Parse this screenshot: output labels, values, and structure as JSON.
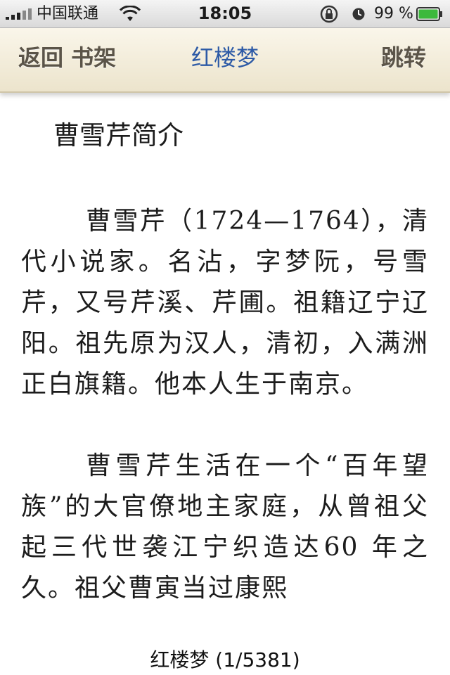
{
  "status_bar": {
    "carrier": "中国联通",
    "time": "18:05",
    "battery_percent": "99 %"
  },
  "nav": {
    "back_label": "返回 书架",
    "title": "红楼梦",
    "jump_label": "跳转"
  },
  "content": {
    "heading": "曹雪芹简介",
    "paragraphs": [
      "曹雪芹（1724—1764），清代小说家。名沾，字梦阮，号雪芹，又号芹溪、芹圃。祖籍辽宁辽阳。祖先原为汉人，清初，入满洲正白旗籍。他本人生于南京。",
      "曹雪芹生活在一个“百年望族”的大官僚地主家庭，从曾祖父起三代世袭江宁织造达60 年之久。祖父曹寅当过康熙"
    ]
  },
  "footer": {
    "book_title": "红楼梦",
    "page_indicator": "(1/5381)"
  },
  "colors": {
    "nav_title": "#2d5aa6",
    "nav_button": "#5b5448",
    "nav_background": "#f3eddb",
    "battery": "#3cb93c"
  },
  "icons": [
    "signal-icon",
    "wifi-icon",
    "rotation-lock-icon",
    "alarm-icon",
    "battery-icon"
  ]
}
